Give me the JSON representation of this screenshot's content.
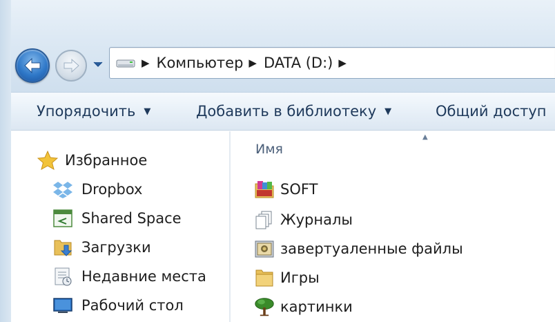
{
  "address_bar": {
    "crumbs": [
      "Компьютер",
      "DATA (D:)"
    ]
  },
  "toolbar": {
    "organize_label": "Упорядочить",
    "add_to_library_label": "Добавить в библиотеку",
    "share_label": "Общий доступ"
  },
  "nav_pane": {
    "favorites_label": "Избранное",
    "items": [
      {
        "label": "Dropbox",
        "icon": "dropbox-icon"
      },
      {
        "label": "Shared Space",
        "icon": "shared-space-icon"
      },
      {
        "label": "Загрузки",
        "icon": "downloads-folder-icon"
      },
      {
        "label": "Недавние места",
        "icon": "recent-places-icon"
      },
      {
        "label": "Рабочий стол",
        "icon": "desktop-icon"
      }
    ]
  },
  "content": {
    "column_name": "Имя",
    "files": [
      {
        "label": "SOFT",
        "icon": "software-folder-icon"
      },
      {
        "label": "Журналы",
        "icon": "documents-stack-icon"
      },
      {
        "label": "завертуаленные файлы",
        "icon": "image-folder-icon"
      },
      {
        "label": "Игры",
        "icon": "folder-icon"
      },
      {
        "label": "картинки",
        "icon": "tree-icon"
      }
    ]
  },
  "colors": {
    "toolbar_text": "#1e395b",
    "folder_yellow": "#e8c05a",
    "back_button_blue": "#2f78c8"
  }
}
